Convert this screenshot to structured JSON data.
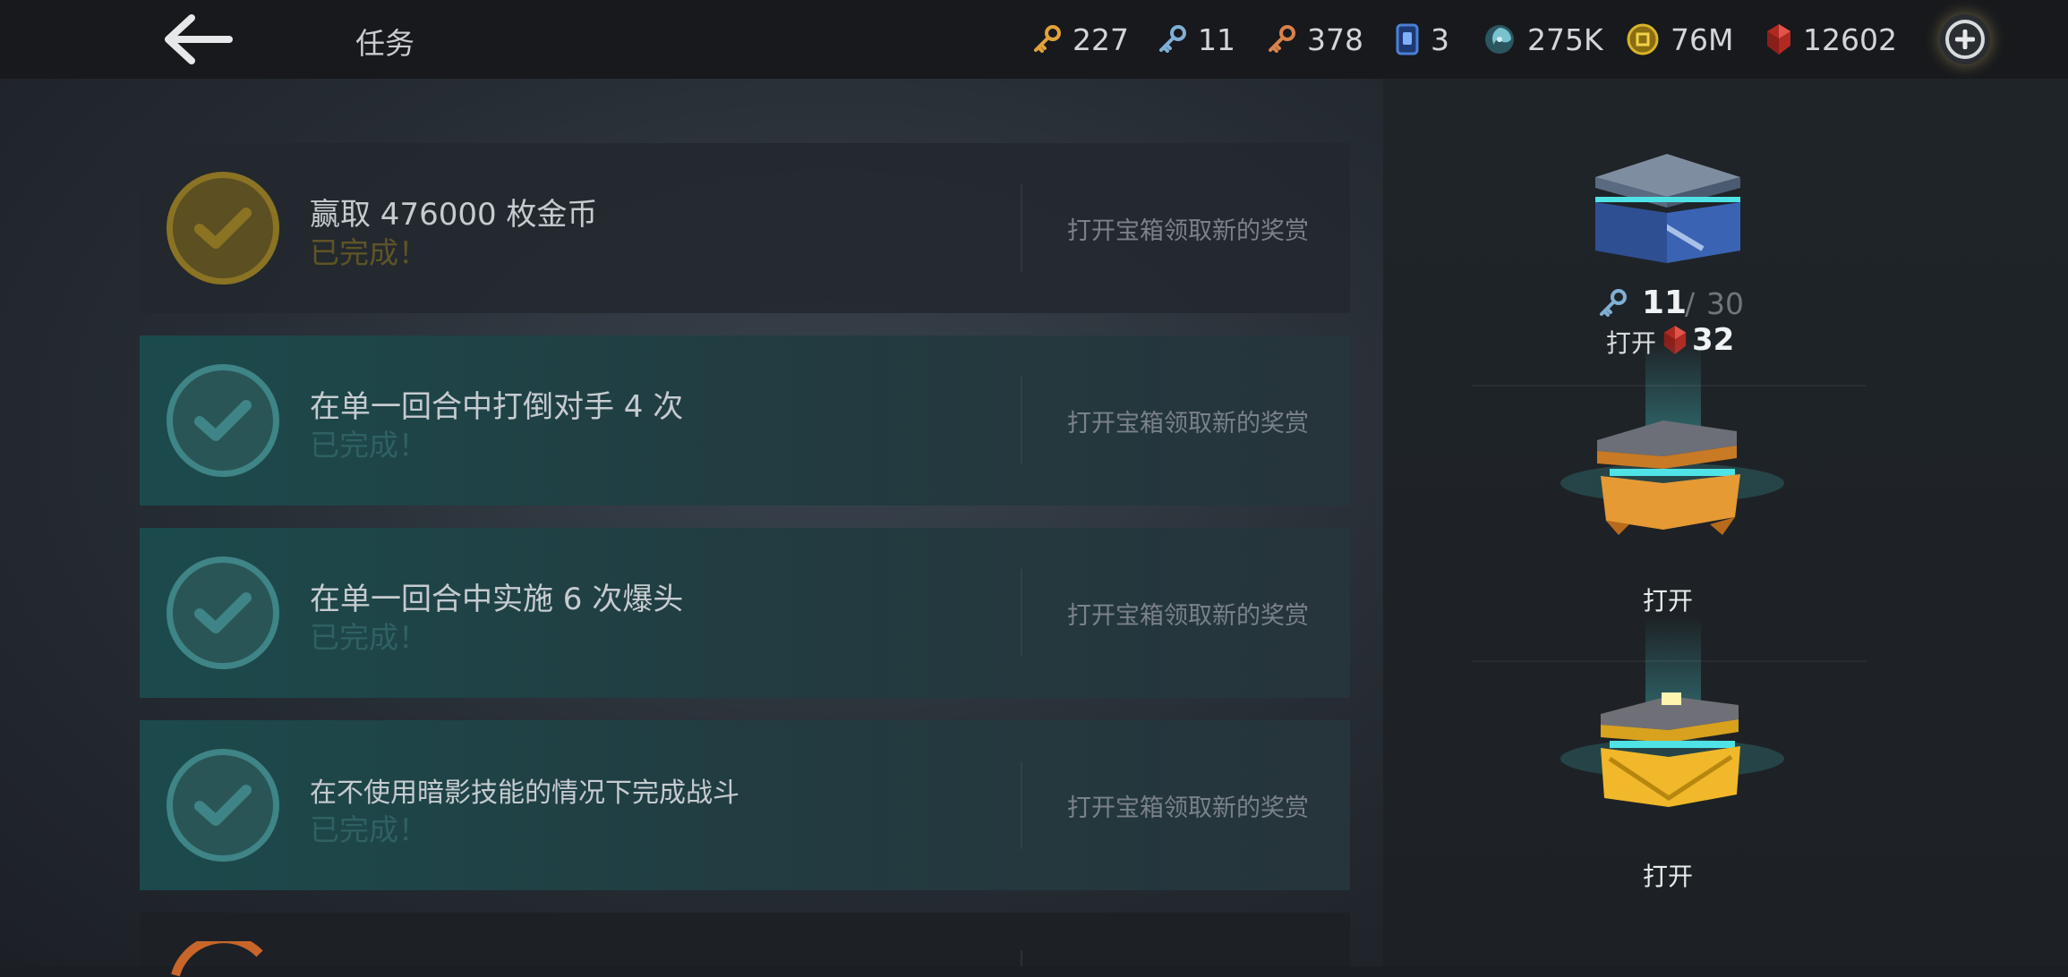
{
  "header": {
    "title": "任务",
    "currencies": [
      {
        "icon": "gold-key-icon",
        "value": "227",
        "color": "#e2a23a"
      },
      {
        "icon": "blue-key-icon",
        "value": "11",
        "color": "#7fb0d4"
      },
      {
        "icon": "bronze-key-icon",
        "value": "378",
        "color": "#d9824a"
      },
      {
        "icon": "card-icon",
        "value": "3",
        "color": "#4a7fd6"
      },
      {
        "icon": "energy-swirl-icon",
        "value": "275K",
        "color": "#79c2d0"
      },
      {
        "icon": "coin-icon",
        "value": "76M",
        "color": "#d8b42a"
      },
      {
        "icon": "ruby-gem-icon",
        "value": "12602",
        "color": "#d43b30"
      }
    ]
  },
  "missions": [
    {
      "title": "赢取 476000 枚金币",
      "status": "已完成！",
      "reward": "打开宝箱领取新的奖赏",
      "theme": "gold"
    },
    {
      "title": "在单一回合中打倒对手 4 次",
      "status": "已完成！",
      "reward": "打开宝箱领取新的奖赏",
      "theme": "teal"
    },
    {
      "title": "在单一回合中实施 6 次爆头",
      "status": "已完成！",
      "reward": "打开宝箱领取新的奖赏",
      "theme": "teal"
    },
    {
      "title": "在不使用暗影技能的情况下完成战斗",
      "status": "已完成！",
      "reward": "打开宝箱领取新的奖赏",
      "theme": "teal"
    }
  ],
  "chests": {
    "blue": {
      "keys_have": "11",
      "keys_sep": "/",
      "keys_need": "30",
      "open_label": "打开",
      "gem_cost": "32"
    },
    "orange": {
      "open_label": "打开"
    },
    "gold": {
      "open_label": "打开"
    }
  },
  "colors": {
    "accent_teal": "#3f8486",
    "accent_gold": "#8a7323",
    "glow": "#4fe3e6"
  }
}
